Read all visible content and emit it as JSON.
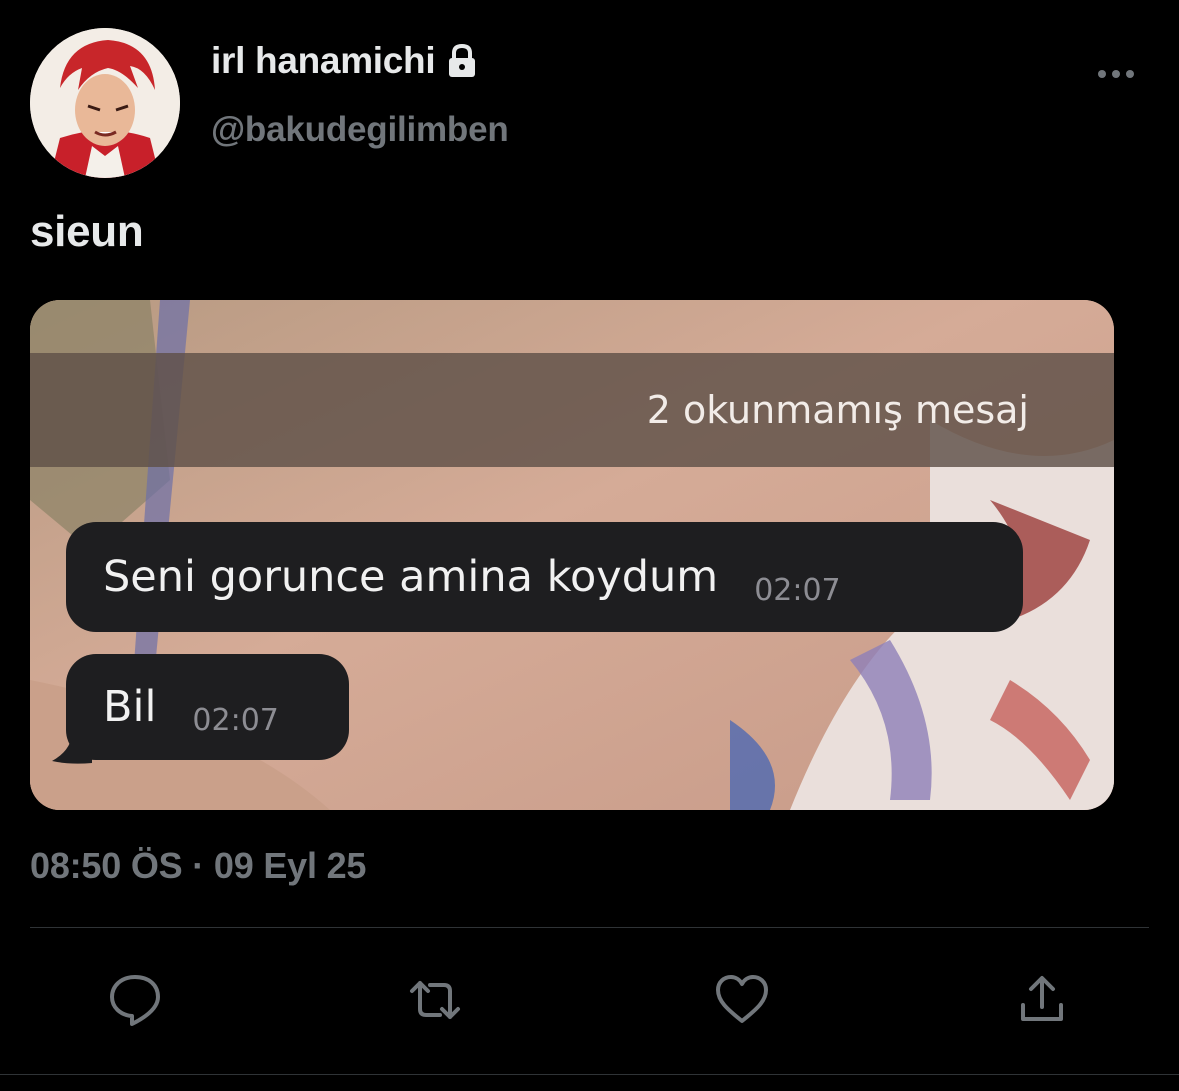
{
  "user": {
    "display_name": "irl hanamichi",
    "handle": "@bakudegilimben",
    "avatar_icon": "anime-character-avatar",
    "protected_icon": "lock-icon"
  },
  "tweet": {
    "text": "sieun",
    "timestamp": "08:50 ÖS · 09 Eyl 25"
  },
  "media": {
    "unread_banner": "2 okunmamış mesaj",
    "messages": [
      {
        "text": "Seni gorunce amina koydum",
        "time": "02:07"
      },
      {
        "text": "Bil",
        "time": "02:07"
      }
    ]
  },
  "actions": {
    "reply_icon": "reply-icon",
    "retweet_icon": "retweet-icon",
    "like_icon": "heart-icon",
    "share_icon": "share-icon"
  },
  "colors": {
    "background": "#000000",
    "primary_text": "#e7e9ea",
    "secondary_text": "#71767b",
    "divider": "#2f3336"
  }
}
